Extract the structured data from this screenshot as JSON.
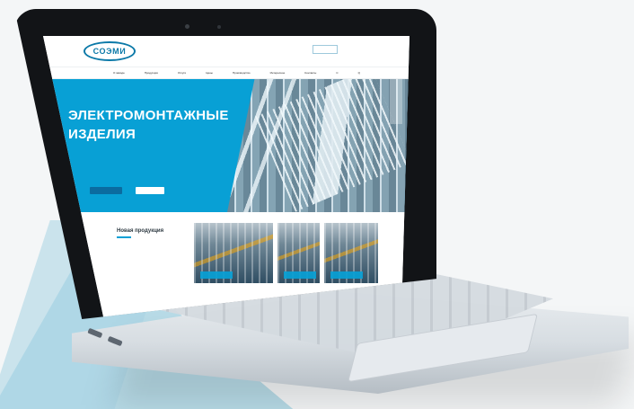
{
  "site": {
    "logo_text": "СОЭМИ",
    "nav_items": [
      "О заводе",
      "Продукция",
      "Услуги",
      "Цены",
      "Производство",
      "Интересное",
      "Контакты",
      "С",
      "Q"
    ],
    "hero": {
      "title_line_1": "ЭЛЕКТРОМОНТАЖНЫЕ",
      "title_line_2": "ИЗДЕЛИЯ"
    },
    "section": {
      "title": "Новая продукция"
    }
  }
}
